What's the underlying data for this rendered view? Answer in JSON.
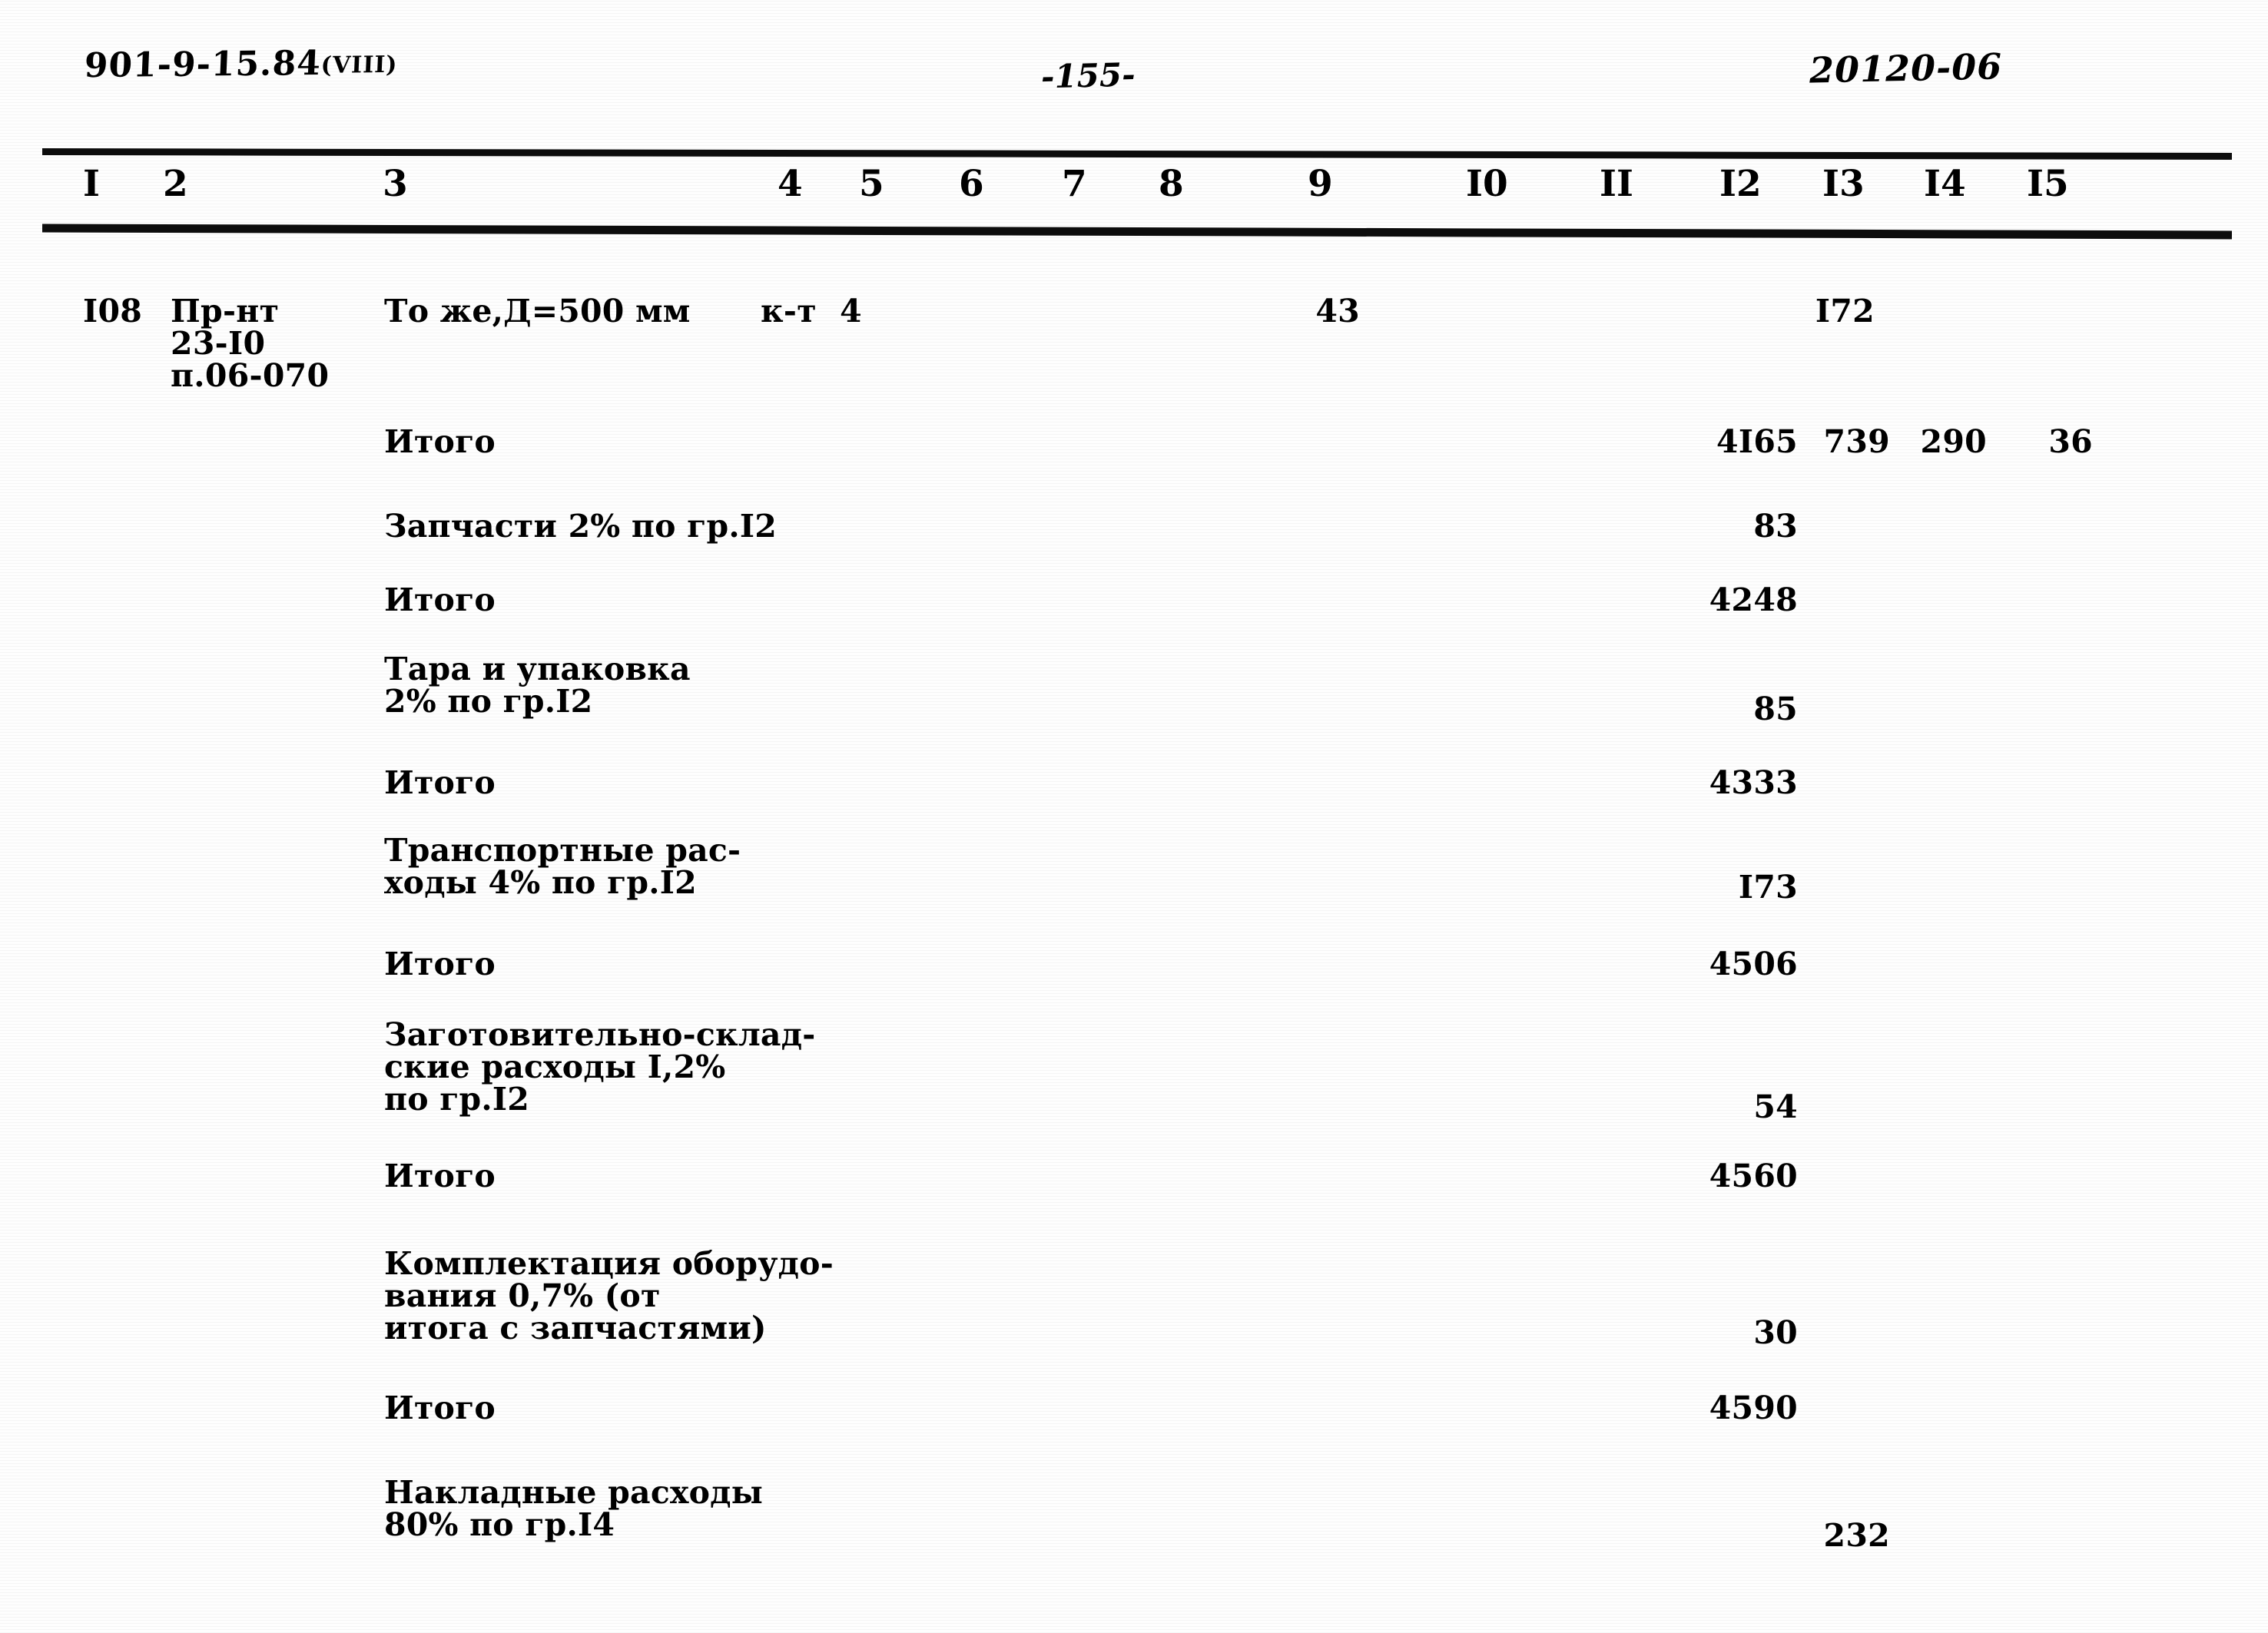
{
  "header": {
    "doc_code": "901-9-15.84",
    "doc_code_roman": "(VIII)",
    "page_number": "-155-",
    "right_code": "20120-06"
  },
  "table": {
    "column_numbers": [
      "I",
      "2",
      "3",
      "4",
      "5",
      "6",
      "7",
      "8",
      "9",
      "I0",
      "II",
      "I2",
      "I3",
      "I4",
      "I5"
    ],
    "rows": [
      {
        "c1": "I08",
        "c2_line1": "Пр-нт",
        "c2_line2": "23-I0",
        "c2_line3": "п.06-070",
        "c3": "То же,Д=500 мм",
        "c4": "к-т",
        "c5": "4",
        "c9": "43",
        "c13": "I72"
      },
      {
        "c3": "Итого",
        "c12": "4I65",
        "c13": "739",
        "c14": "290",
        "c15": "36"
      },
      {
        "c3": "Запчасти 2% по гр.I2",
        "c12": "83"
      },
      {
        "c3": "Итого",
        "c12": "4248"
      },
      {
        "c3_line1": "Тара и упаковка",
        "c3_line2": "2% по гр.I2",
        "c12": "85"
      },
      {
        "c3": "Итого",
        "c12": "4333"
      },
      {
        "c3_line1": "Транспортные рас-",
        "c3_line2": "ходы 4% по гр.I2",
        "c12": "I73"
      },
      {
        "c3": "Итого",
        "c12": "4506"
      },
      {
        "c3_line1": "Заготовительно-склад-",
        "c3_line2": "ские расходы I,2%",
        "c3_line3": "по гр.I2",
        "c12": "54"
      },
      {
        "c3": "Итого",
        "c12": "4560"
      },
      {
        "c3_line1": "Комплектация оборудо-",
        "c3_line2": "вания 0,7% (от",
        "c3_line3": "итога с запчастями)",
        "c12": "30"
      },
      {
        "c3": "Итого",
        "c12": "4590"
      },
      {
        "c3_line1": "Накладные расходы",
        "c3_line2": "80% по гр.I4",
        "c13": "232"
      }
    ]
  }
}
